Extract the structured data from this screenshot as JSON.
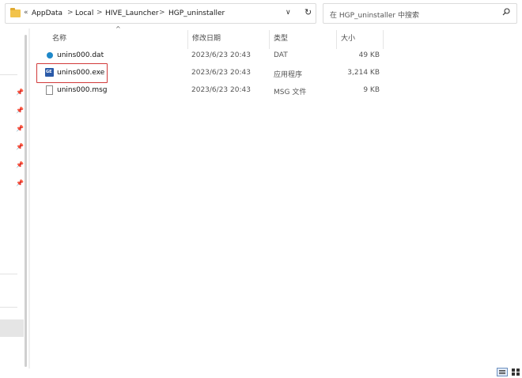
{
  "address_bar": {
    "more": "«",
    "breadcrumbs": [
      "AppData",
      "Local",
      "HIVE_Launcher",
      "HGP_uninstaller"
    ],
    "separator": ">",
    "dropdown_glyph": "∨",
    "refresh_glyph": "↻"
  },
  "search": {
    "placeholder": "在 HGP_uninstaller 中搜索"
  },
  "columns": {
    "name": "名称",
    "date_modified": "修改日期",
    "type": "类型",
    "size": "大小"
  },
  "files": [
    {
      "name": "unins000.dat",
      "date": "2023/6/23 20:43",
      "type": "DAT",
      "size": "49 KB",
      "icon": "dat-file-icon"
    },
    {
      "name": "unins000.exe",
      "date": "2023/6/23 20:43",
      "type": "应用程序",
      "size": "3,214 KB",
      "icon": "exe-file-icon",
      "highlighted": true
    },
    {
      "name": "unins000.msg",
      "date": "2023/6/23 20:43",
      "type": "MSG 文件",
      "size": "9 KB",
      "icon": "msg-file-icon"
    }
  ],
  "exe_icon_text": "GE",
  "colors": {
    "highlight_border": "#d13a3a",
    "folder": "#f2c34b",
    "dat_icon": "#1e88c9",
    "exe_icon": "#2a5aa8"
  }
}
